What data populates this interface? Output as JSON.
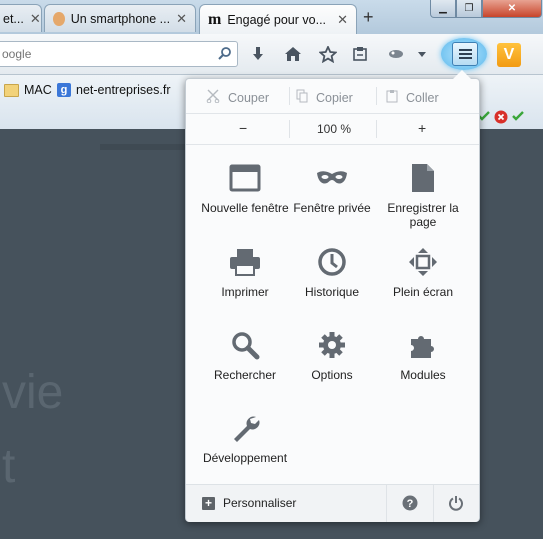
{
  "tabs": [
    {
      "label": "et..."
    },
    {
      "label": "Un smartphone ..."
    },
    {
      "label": "Engagé pour vo..."
    }
  ],
  "urlbar": {
    "placeholder": "oogle"
  },
  "bookmarks": [
    {
      "label": "MAC"
    },
    {
      "label": "net-entreprises.fr"
    }
  ],
  "menu": {
    "edit": {
      "cut": "Couper",
      "copy": "Copier",
      "paste": "Coller"
    },
    "zoom": {
      "minus": "−",
      "level": "100 %",
      "plus": "+"
    },
    "items": [
      {
        "label": "Nouvelle fenêtre",
        "icon": "new-window-icon"
      },
      {
        "label": "Fenêtre privée",
        "icon": "private-mask-icon"
      },
      {
        "label": "Enregistrer la page",
        "icon": "save-page-icon"
      },
      {
        "label": "Imprimer",
        "icon": "printer-icon"
      },
      {
        "label": "Historique",
        "icon": "clock-icon"
      },
      {
        "label": "Plein écran",
        "icon": "fullscreen-icon"
      },
      {
        "label": "Rechercher",
        "icon": "magnifier-icon"
      },
      {
        "label": "Options",
        "icon": "gear-icon"
      },
      {
        "label": "Modules",
        "icon": "puzzle-icon"
      },
      {
        "label": "Dévelop­pe­ment",
        "icon": "wrench-icon"
      }
    ],
    "footer": {
      "customize": "Personnaliser"
    }
  },
  "page": {
    "line1": "vie",
    "line2": "t"
  },
  "colors": {
    "menu_button_glow": "#7fcaf3",
    "page_bg": "#46525c"
  }
}
